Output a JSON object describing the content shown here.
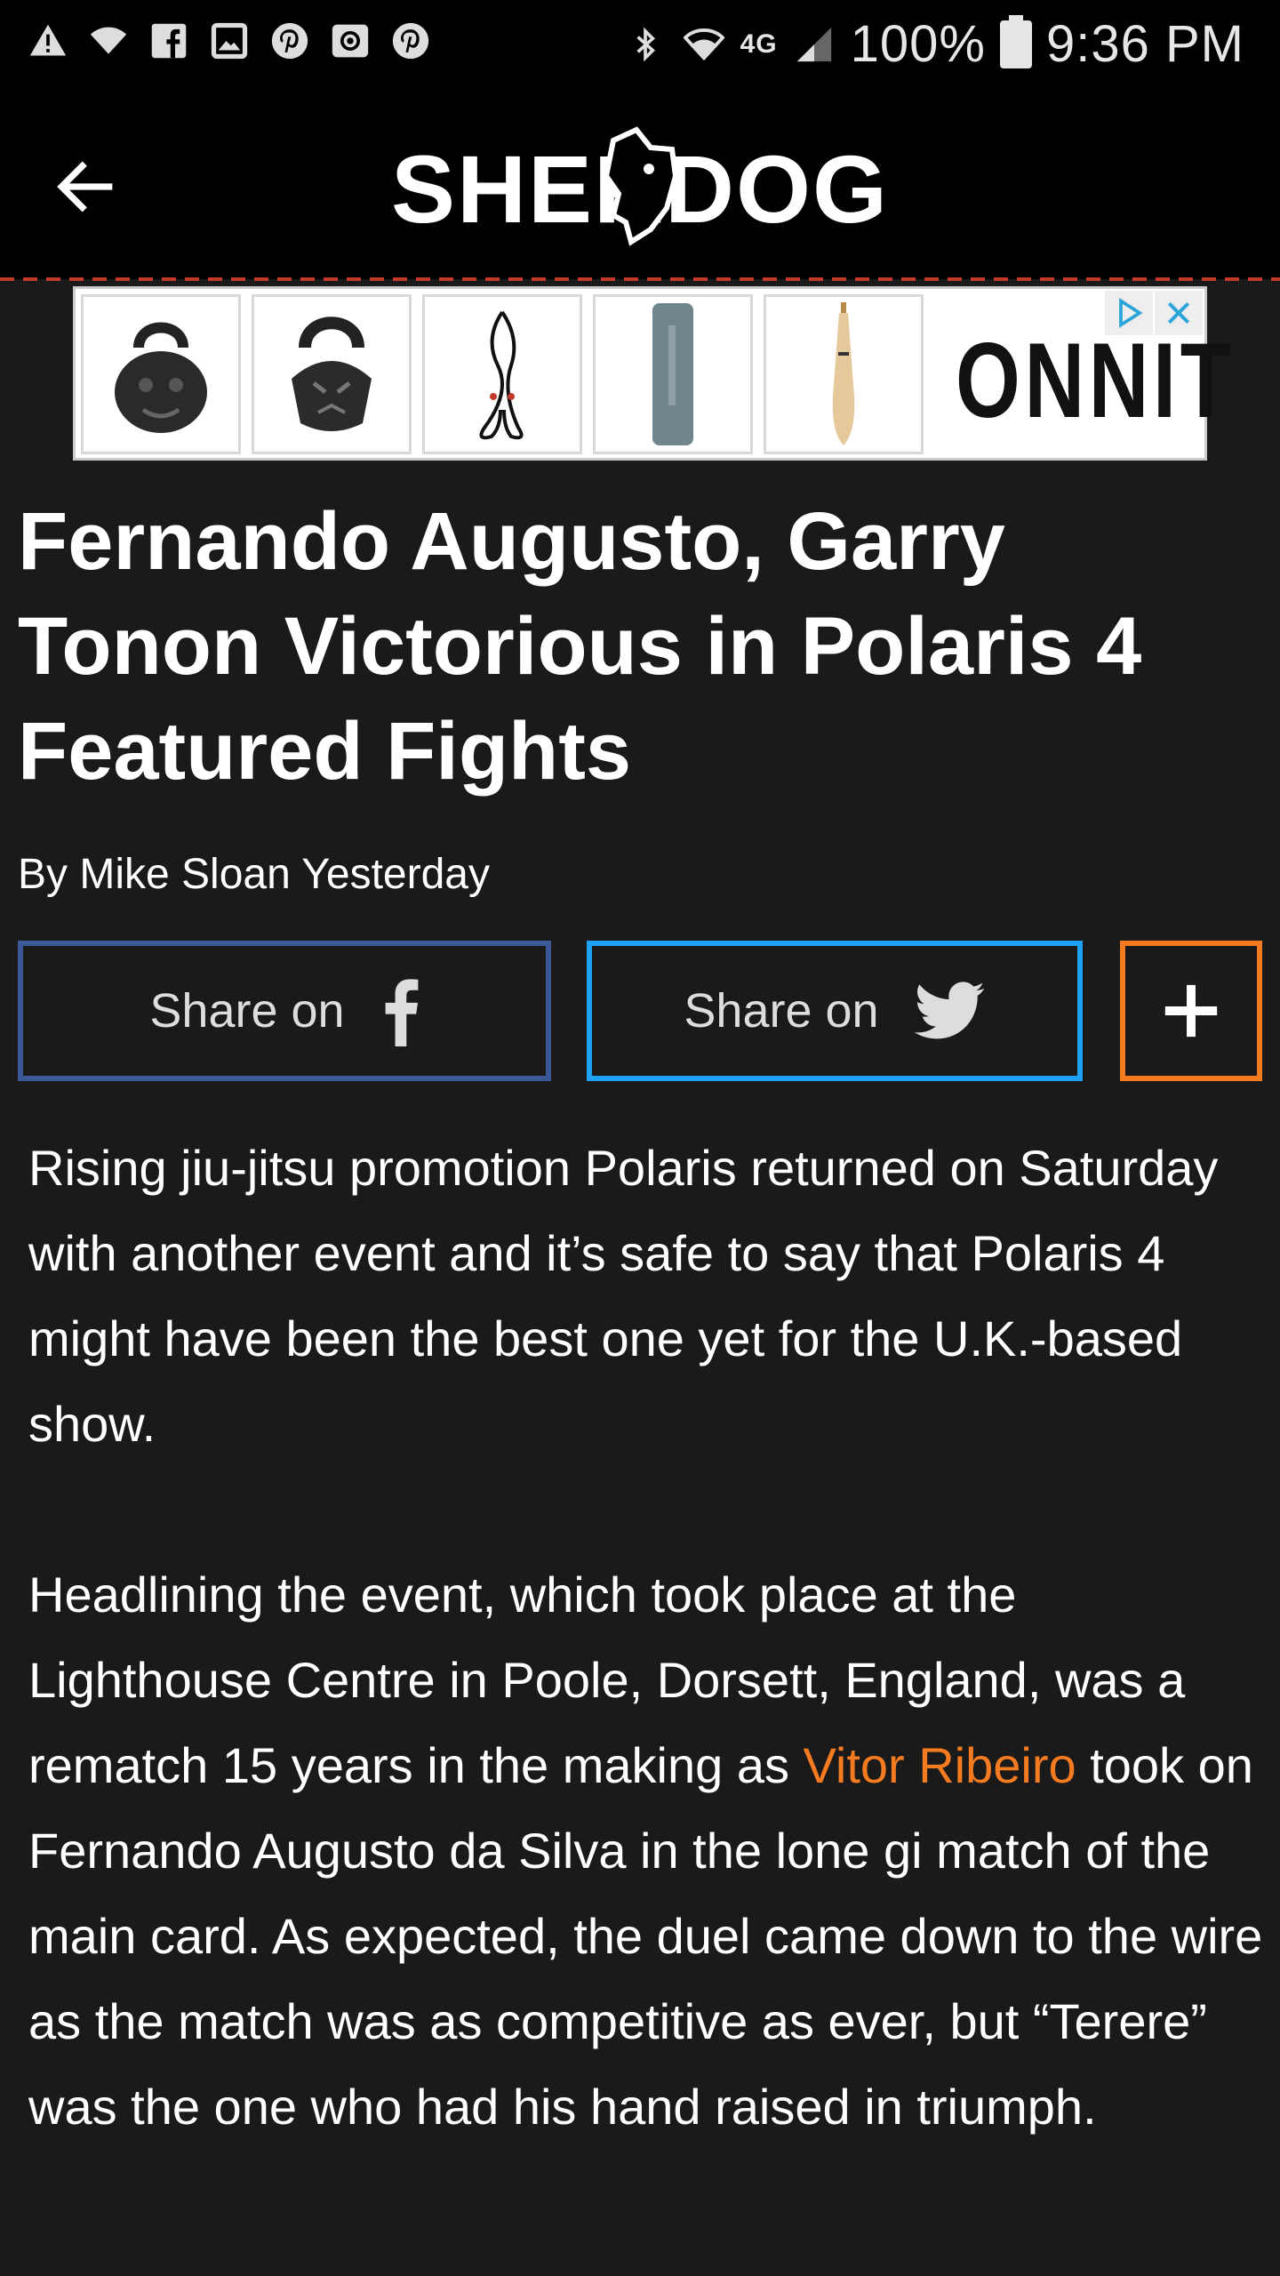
{
  "status_bar": {
    "battery": "100%",
    "time": "9:36 PM",
    "network": "4G",
    "icons_left": [
      "warning-icon",
      "wifi-icon",
      "facebook-icon",
      "gallery-icon",
      "pinterest-icon",
      "email-icon",
      "pinterest-icon"
    ],
    "icons_right": [
      "bluetooth-icon",
      "wifi-icon",
      "signal-icon",
      "battery-icon"
    ]
  },
  "header": {
    "logo_text": "SHERDOG",
    "back_icon": "arrow-left-icon"
  },
  "ad": {
    "brand": "ONNIT",
    "products": [
      "kettlebell-icon",
      "kettlebell-icon",
      "rope-icon",
      "foam-roller-icon",
      "club-icon"
    ]
  },
  "article": {
    "title": "Fernando Augusto, Garry Tonon Victorious in Polaris 4 Featured Fights",
    "byline": "By Mike Sloan Yesterday",
    "share_facebook_label": "Share on",
    "share_twitter_label": "Share on",
    "paragraph1": "Rising jiu-jitsu promotion Polaris returned on Saturday with another event and it’s safe to say that Polaris 4 might have been the best one yet for the U.K.-based show.",
    "paragraph2_before": "Headlining the event, which took place at the Lighthouse Centre in Poole, Dorsett, England, was a rematch 15 years in the making as ",
    "paragraph2_link": "Vitor Ribeiro",
    "paragraph2_after": " took on Fernando Augusto da Silva in the lone gi match of the main card. As expected, the duel came down to the wire as the match was as competitive as ever, but “Terere” was the one who had his hand raised in triumph."
  },
  "colors": {
    "facebook": "#3b5998",
    "twitter": "#1da1f2",
    "accent": "#f47b20",
    "background": "#1a1a1a"
  }
}
